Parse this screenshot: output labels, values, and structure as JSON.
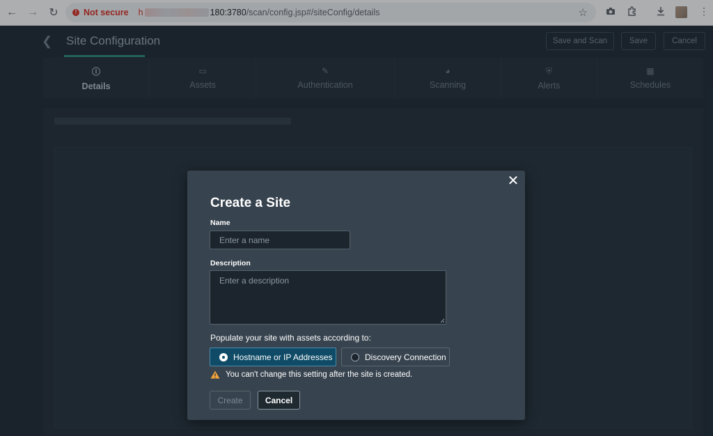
{
  "browser": {
    "security_label": "Not secure",
    "url_host_prefix": "h",
    "url_port": "180:3780",
    "url_path": "/scan/config.jsp#/siteConfig/details"
  },
  "page": {
    "title": "Site Configuration",
    "header_buttons": {
      "save_and_scan": "Save and Scan",
      "save": "Save",
      "cancel": "Cancel"
    },
    "tabs": [
      {
        "label": "Details",
        "icon": "info-icon",
        "active": true
      },
      {
        "label": "Assets",
        "icon": "monitor-icon",
        "active": false
      },
      {
        "label": "Authentication",
        "icon": "edit-icon",
        "active": false
      },
      {
        "label": "Scanning",
        "icon": "gauge-icon",
        "active": false
      },
      {
        "label": "Alerts",
        "icon": "shield-icon",
        "active": false
      },
      {
        "label": "Schedules",
        "icon": "calendar-icon",
        "active": false
      }
    ]
  },
  "modal": {
    "title": "Create a Site",
    "name_label": "Name",
    "name_placeholder": "Enter a name",
    "name_value": "",
    "description_label": "Description",
    "description_placeholder": "Enter a description",
    "description_value": "",
    "populate_text": "Populate your site with assets according to:",
    "options": [
      {
        "label": "Hostname or IP Addresses",
        "selected": true
      },
      {
        "label": "Discovery Connection",
        "selected": false
      }
    ],
    "warning_text": "You can't change this setting after the site is created.",
    "create_label": "Create",
    "cancel_label": "Cancel"
  },
  "colors": {
    "modal_bg": "#37434e",
    "selected_option": "#0f4a66",
    "warning": "#f2a33a",
    "page_bg": "#1f2a33"
  }
}
